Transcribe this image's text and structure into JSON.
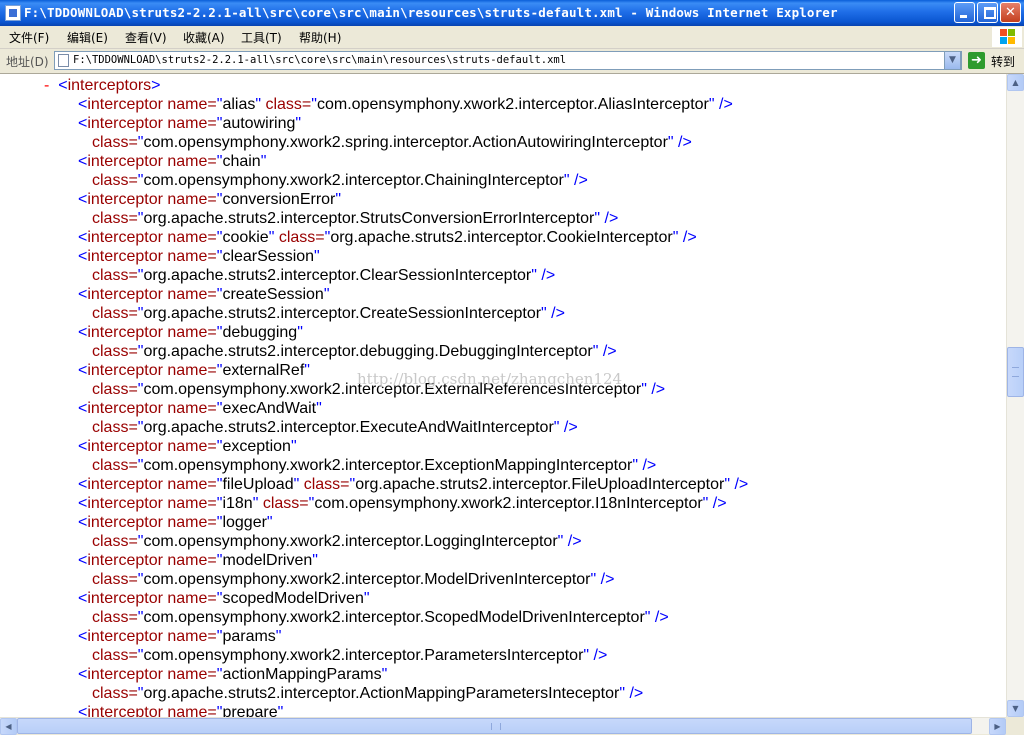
{
  "window": {
    "title": "F:\\TDDOWNLOAD\\struts2-2.2.1-all\\src\\core\\src\\main\\resources\\struts-default.xml - Windows Internet Explorer",
    "min_glyph": "_",
    "max_glyph": "□",
    "close_glyph": "✕"
  },
  "menu": {
    "items": [
      "文件(F)",
      "编辑(E)",
      "查看(V)",
      "收藏(A)",
      "工具(T)",
      "帮助(H)"
    ]
  },
  "address": {
    "label": "地址(D)",
    "url": "F:\\TDDOWNLOAD\\struts2-2.2.1-all\\src\\core\\src\\main\\resources\\struts-default.xml",
    "go_label": "转到",
    "dropdown_glyph": "▼",
    "go_glyph": "➜"
  },
  "content": {
    "collapse_toggle": "-",
    "parent_tag": "interceptors",
    "elements": [
      {
        "tag": "interceptor",
        "name": "alias",
        "class": "com.opensymphony.xwork2.interceptor.AliasInterceptor",
        "wrap": false
      },
      {
        "tag": "interceptor",
        "name": "autowiring",
        "class": "com.opensymphony.xwork2.spring.interceptor.ActionAutowiringInterceptor",
        "wrap": true
      },
      {
        "tag": "interceptor",
        "name": "chain",
        "class": "com.opensymphony.xwork2.interceptor.ChainingInterceptor",
        "wrap": true
      },
      {
        "tag": "interceptor",
        "name": "conversionError",
        "class": "org.apache.struts2.interceptor.StrutsConversionErrorInterceptor",
        "wrap": true
      },
      {
        "tag": "interceptor",
        "name": "cookie",
        "class": "org.apache.struts2.interceptor.CookieInterceptor",
        "wrap": false
      },
      {
        "tag": "interceptor",
        "name": "clearSession",
        "class": "org.apache.struts2.interceptor.ClearSessionInterceptor",
        "wrap": true
      },
      {
        "tag": "interceptor",
        "name": "createSession",
        "class": "org.apache.struts2.interceptor.CreateSessionInterceptor",
        "wrap": true
      },
      {
        "tag": "interceptor",
        "name": "debugging",
        "class": "org.apache.struts2.interceptor.debugging.DebuggingInterceptor",
        "wrap": true
      },
      {
        "tag": "interceptor",
        "name": "externalRef",
        "class": "com.opensymphony.xwork2.interceptor.ExternalReferencesInterceptor",
        "wrap": true
      },
      {
        "tag": "interceptor",
        "name": "execAndWait",
        "class": "org.apache.struts2.interceptor.ExecuteAndWaitInterceptor",
        "wrap": true
      },
      {
        "tag": "interceptor",
        "name": "exception",
        "class": "com.opensymphony.xwork2.interceptor.ExceptionMappingInterceptor",
        "wrap": true
      },
      {
        "tag": "interceptor",
        "name": "fileUpload",
        "class": "org.apache.struts2.interceptor.FileUploadInterceptor",
        "wrap": false
      },
      {
        "tag": "interceptor",
        "name": "i18n",
        "class": "com.opensymphony.xwork2.interceptor.I18nInterceptor",
        "wrap": false
      },
      {
        "tag": "interceptor",
        "name": "logger",
        "class": "com.opensymphony.xwork2.interceptor.LoggingInterceptor",
        "wrap": true
      },
      {
        "tag": "interceptor",
        "name": "modelDriven",
        "class": "com.opensymphony.xwork2.interceptor.ModelDrivenInterceptor",
        "wrap": true
      },
      {
        "tag": "interceptor",
        "name": "scopedModelDriven",
        "class": "com.opensymphony.xwork2.interceptor.ScopedModelDrivenInterceptor",
        "wrap": true
      },
      {
        "tag": "interceptor",
        "name": "params",
        "class": "com.opensymphony.xwork2.interceptor.ParametersInterceptor",
        "wrap": true
      },
      {
        "tag": "interceptor",
        "name": "actionMappingParams",
        "class": "org.apache.struts2.interceptor.ActionMappingParametersInteceptor",
        "wrap": true
      },
      {
        "tag": "interceptor",
        "name": "prepare",
        "class": "",
        "wrap": true
      }
    ],
    "watermark": "http://blog.csdn.net/zhangchen124"
  },
  "colors": {
    "markup": "#0000ff",
    "tag_name": "#990000",
    "attr_value": "#000000",
    "toggle": "#ff0000"
  }
}
